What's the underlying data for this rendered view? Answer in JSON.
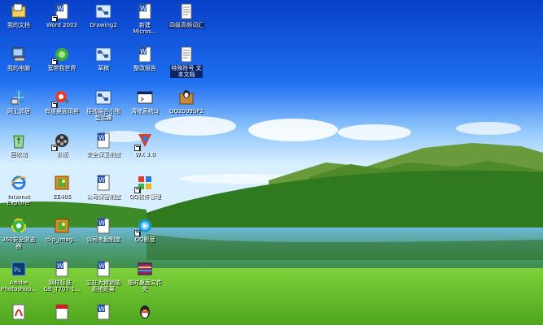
{
  "desktop": {
    "icons": [
      {
        "label": "我的文档",
        "icon": "my-documents-icon"
      },
      {
        "label": "Word 2003",
        "icon": "word-doc-icon"
      },
      {
        "label": "Drawing2",
        "icon": "visio-drawing-icon"
      },
      {
        "label": "新建\nMicros...",
        "icon": "word-doc-icon"
      },
      {
        "label": "四级高频词汇",
        "icon": "text-file-icon"
      },
      {
        "label": "我的电脑",
        "icon": "my-computer-icon"
      },
      {
        "label": "宽带我世界",
        "icon": "broadband-icon"
      },
      {
        "label": "草稿",
        "icon": "visio-drawing-icon"
      },
      {
        "label": "整改报告",
        "icon": "word-doc-icon"
      },
      {
        "label": "特殊符号 文\n本文档",
        "icon": "text-file-icon"
      },
      {
        "label": "网上邻居",
        "icon": "network-places-icon"
      },
      {
        "label": "有道桌面词典",
        "icon": "youdao-dict-icon"
      },
      {
        "label": "接线端合小拖\n垫活腰",
        "icon": "visio-drawing-icon"
      },
      {
        "label": "清除系统LJ",
        "icon": "batch-file-icon"
      },
      {
        "label": "QQ2009SP2",
        "icon": "qq-installer-icon"
      },
      {
        "label": "回收站",
        "icon": "recycle-bin-icon"
      },
      {
        "label": "影视",
        "icon": "film-reel-icon"
      },
      {
        "label": "安全保卫制度",
        "icon": "word-doc-icon"
      },
      {
        "label": "WX 3.0",
        "icon": "wx-app-icon"
      },
      {
        "label": "Internet\nExplorer",
        "icon": "internet-explorer-icon"
      },
      {
        "label": "EE405",
        "icon": "image-file-icon"
      },
      {
        "label": "公司保密制度",
        "icon": "word-doc-icon"
      },
      {
        "label": "QQ软件管理",
        "icon": "qq-software-manager-icon"
      },
      {
        "label": "360安全浏览\n器",
        "icon": "browser-360-icon"
      },
      {
        "label": "clip_imag...",
        "icon": "image-file-icon"
      },
      {
        "label": "公司考勤制度",
        "icon": "word-doc-icon"
      },
      {
        "label": "QQ影音",
        "icon": "qq-player-icon"
      },
      {
        "label": "Adobe\nPhotoshop...",
        "icon": "photoshop-icon"
      },
      {
        "label": "钢材标准 -\nGB_T707-1...",
        "icon": "word-doc-icon"
      },
      {
        "label": "立柱大臂销轴\n距地距离",
        "icon": "word-doc-icon"
      },
      {
        "label": "临时桌面文件\n夹",
        "icon": "winrar-archive-icon"
      },
      {
        "label": "",
        "icon": "pdf-icon"
      },
      {
        "label": "",
        "icon": "pdf-icon"
      },
      {
        "label": "",
        "icon": "word-doc-icon"
      },
      {
        "label": "",
        "icon": "qq-penguin-icon"
      }
    ]
  }
}
